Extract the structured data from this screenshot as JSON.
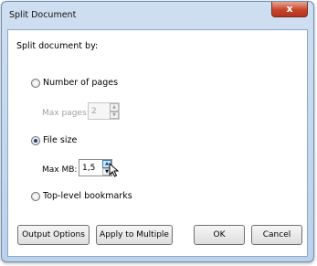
{
  "window": {
    "title": "Split Document",
    "close_label": "x"
  },
  "form": {
    "heading": "Split document by:",
    "pages_option": {
      "label": "Number of pages",
      "max_label": "Max pages:",
      "max_value": "2"
    },
    "size_option": {
      "label": "File size",
      "max_label": "Max MB:",
      "max_value": "1,5"
    },
    "bookmarks_option": {
      "label": "Top-level bookmarks"
    }
  },
  "buttons": {
    "output_options": "Output Options",
    "apply_multiple": "Apply to Multiple",
    "ok": "OK",
    "cancel": "Cancel"
  }
}
